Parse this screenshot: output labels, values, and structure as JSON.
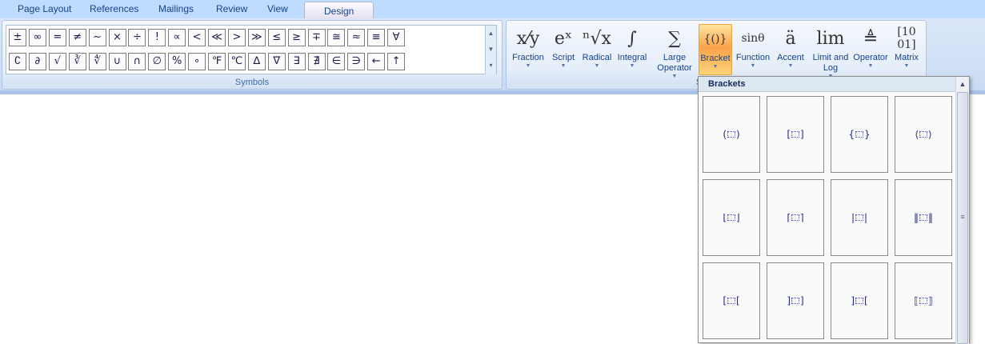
{
  "tabs": [
    {
      "label": "Page Layout"
    },
    {
      "label": "References"
    },
    {
      "label": "Mailings"
    },
    {
      "label": "Review"
    },
    {
      "label": "View"
    },
    {
      "label": "Design",
      "active": true
    }
  ],
  "symbols": {
    "label": "Symbols",
    "row1": [
      "±",
      "∞",
      "=",
      "≠",
      "~",
      "×",
      "÷",
      "!",
      "∝",
      "<",
      "≪",
      ">",
      "≫",
      "≤",
      "≥",
      "∓",
      "≅",
      "≈",
      "≡",
      "∀"
    ],
    "row2": [
      "∁",
      "∂",
      "√",
      "∛",
      "∜",
      "∪",
      "∩",
      "∅",
      "%",
      "∘",
      "℉",
      "℃",
      "∆",
      "∇",
      "∃",
      "∄",
      "∈",
      "∋",
      "←",
      "↑"
    ]
  },
  "structures": {
    "label": "Structures",
    "buttons": [
      {
        "label": "Fraction",
        "icon": "fraction-icon",
        "glyph": "x⁄y"
      },
      {
        "label": "Script",
        "icon": "script-icon",
        "glyph": "eˣ"
      },
      {
        "label": "Radical",
        "icon": "radical-icon",
        "glyph": "ⁿ√x"
      },
      {
        "label": "Integral",
        "icon": "integral-icon",
        "glyph": "∫"
      },
      {
        "label": "Large Operator",
        "icon": "sum-icon",
        "glyph": "∑"
      },
      {
        "label": "Bracket",
        "icon": "bracket-icon",
        "glyph": "{()}",
        "selected": true
      },
      {
        "label": "Function",
        "icon": "function-icon",
        "glyph": "sinθ"
      },
      {
        "label": "Accent",
        "icon": "accent-icon",
        "glyph": "ä"
      },
      {
        "label": "Limit and Log",
        "icon": "limit-icon",
        "glyph": "lim"
      },
      {
        "label": "Operator",
        "icon": "operator-icon",
        "glyph": "≜"
      },
      {
        "label": "Matrix",
        "icon": "matrix-icon",
        "glyph": "[10 01]"
      }
    ]
  },
  "dropdown": {
    "title": "Brackets",
    "items": [
      [
        "(",
        ")"
      ],
      [
        "[",
        "]"
      ],
      [
        "{",
        "}"
      ],
      [
        "⟨",
        "⟩"
      ],
      [
        "⌊",
        "⌋"
      ],
      [
        "⌈",
        "⌉"
      ],
      [
        "|",
        "|"
      ],
      [
        "‖",
        "‖"
      ],
      [
        "[",
        "["
      ],
      [
        "]",
        "]"
      ],
      [
        "]",
        "["
      ],
      [
        "⟦",
        "⟧"
      ]
    ]
  }
}
